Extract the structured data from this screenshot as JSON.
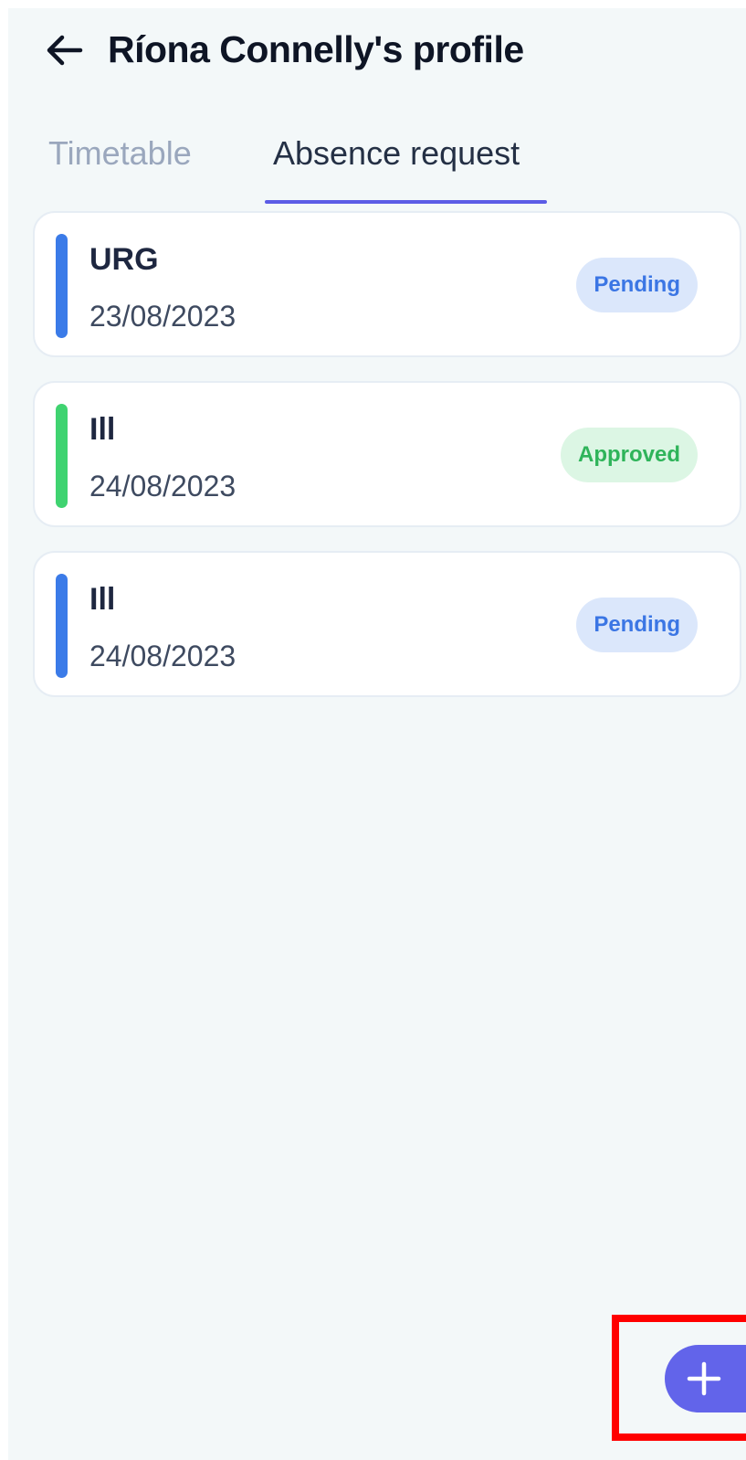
{
  "header": {
    "title": "Ríona Connelly's profile",
    "back_icon": "arrow-left-icon"
  },
  "tabs": [
    {
      "label": "Timetable",
      "active": false
    },
    {
      "label": "Absence request",
      "active": true
    }
  ],
  "colors": {
    "accent": "#5b5ce6",
    "pending_bar": "#3b7be8",
    "approved_bar": "#3fd370",
    "pending_badge_bg": "#dbe7fb",
    "pending_badge_text": "#3b76e4",
    "approved_badge_bg": "#dcf6e4",
    "approved_badge_text": "#2fb45a",
    "fab": "#6264ea",
    "highlight": "#ff0000"
  },
  "requests": [
    {
      "type": "URG",
      "date": "23/08/2023",
      "status": "Pending"
    },
    {
      "type": "Ill",
      "date": "24/08/2023",
      "status": "Approved"
    },
    {
      "type": "Ill",
      "date": "24/08/2023",
      "status": "Pending"
    }
  ],
  "fab": {
    "icon": "plus-icon"
  }
}
